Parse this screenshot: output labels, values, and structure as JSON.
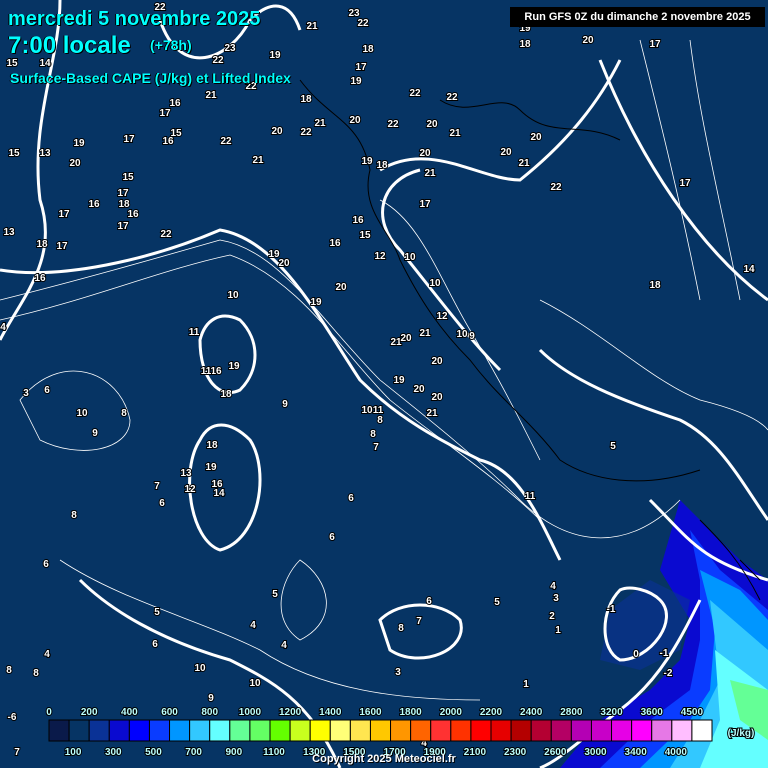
{
  "header": {
    "date": "mercredi 5 novembre 2025",
    "time": "7:00 locale",
    "lead": "(+78h)",
    "parameter": "Surface-Based CAPE (J/kg) et Lifted Index",
    "run": "Run GFS 0Z du dimanche 2 novembre 2025"
  },
  "colorbar": {
    "unit": "(J/kg)",
    "top_labels": [
      "0",
      "200",
      "400",
      "600",
      "800",
      "1000",
      "1200",
      "1400",
      "1600",
      "1800",
      "2000",
      "2200",
      "2400",
      "2800",
      "3200",
      "3600",
      "4500"
    ],
    "bottom_labels": [
      "100",
      "300",
      "500",
      "700",
      "900",
      "1100",
      "1300",
      "1500",
      "1700",
      "1900",
      "2100",
      "2300",
      "2600",
      "3000",
      "3400",
      "4000"
    ],
    "colors": [
      "#0a1a4a",
      "#063464",
      "#0a3296",
      "#0a0ad0",
      "#0000ff",
      "#0a3cff",
      "#0096ff",
      "#32c8ff",
      "#64ffff",
      "#64ff96",
      "#64ff64",
      "#64ff00",
      "#c8ff1e",
      "#ffff00",
      "#ffff78",
      "#ffe650",
      "#ffc800",
      "#ff9600",
      "#ff6400",
      "#ff3232",
      "#ff3200",
      "#ff0000",
      "#e60000",
      "#b40000",
      "#b40032",
      "#b40064",
      "#b400b4",
      "#c800c8",
      "#e600e6",
      "#ff00ff",
      "#e678e6",
      "#ffbeff",
      "#ffffff"
    ]
  },
  "lifted_index_labels": [
    "22",
    "21",
    "23",
    "22",
    "19",
    "23",
    "22",
    "18",
    "17",
    "19",
    "15",
    "14",
    "21",
    "22",
    "18",
    "16",
    "17",
    "21",
    "20",
    "22",
    "22",
    "22",
    "20",
    "21",
    "17",
    "15",
    "16",
    "19",
    "20",
    "13",
    "15",
    "22",
    "20",
    "22",
    "21",
    "19",
    "18",
    "20",
    "21",
    "17",
    "20",
    "21",
    "20",
    "22",
    "17",
    "19",
    "18",
    "20",
    "17",
    "15",
    "17",
    "18",
    "16",
    "17",
    "16",
    "17",
    "22",
    "18",
    "17",
    "13",
    "16",
    "15",
    "16",
    "19",
    "20",
    "12",
    "10",
    "10",
    "20",
    "18",
    "14",
    "16",
    "10",
    "19",
    "12",
    "21",
    "20",
    "21",
    "10",
    "9",
    "11",
    "20",
    "19",
    "20",
    "20",
    "21",
    "10",
    "11",
    "8",
    "8",
    "7",
    "19",
    "16",
    "11",
    "18",
    "9",
    "3",
    "6",
    "4",
    "10",
    "8",
    "9",
    "18",
    "19",
    "13",
    "16",
    "12",
    "14",
    "7",
    "6",
    "6",
    "11",
    "5",
    "8",
    "6",
    "6",
    "5",
    "5",
    "4",
    "6",
    "5",
    "4",
    "3",
    "2",
    "1",
    "-1",
    "0",
    "-1",
    "-2",
    "8",
    "7",
    "6",
    "4",
    "4",
    "10",
    "3",
    "8",
    "8",
    "1",
    "10",
    "9",
    "-6",
    "7",
    "4"
  ],
  "copyright": "Copyright 2025 Meteociel.fr"
}
